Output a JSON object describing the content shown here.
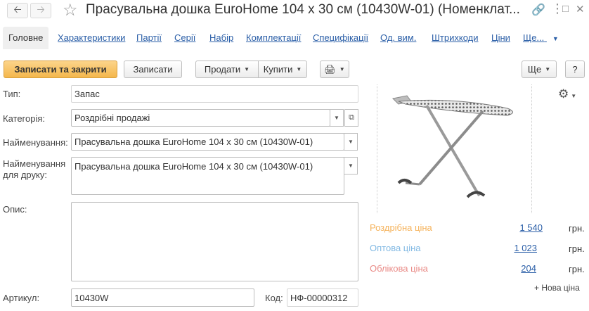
{
  "window": {
    "title": "Прасувальна дошка EuroHome 104 x 30 см (10430W-01) (Номенклат..."
  },
  "tabs": [
    {
      "label": "Головне"
    },
    {
      "label": "Характеристики"
    },
    {
      "label": "Партії"
    },
    {
      "label": "Серії"
    },
    {
      "label": "Набір"
    },
    {
      "label": "Комплектації"
    },
    {
      "label": "Специфікації"
    },
    {
      "label": "Од. вим."
    },
    {
      "label": "Штрихкоди"
    },
    {
      "label": "Ціни"
    },
    {
      "label": "Ще..."
    }
  ],
  "toolbar": {
    "save_close": "Записати та закрити",
    "save": "Записати",
    "sell": "Продати",
    "buy": "Купити",
    "more": "Ще",
    "help": "?"
  },
  "form": {
    "type_label": "Тип:",
    "type_value": "Запас",
    "category_label": "Категорія:",
    "category_value": "Роздрібні продажі",
    "name_label": "Найменування:",
    "name_value": "Прасувальна дошка EuroHome 104 x 30 см (10430W-01)",
    "print_name_label_1": "Найменування",
    "print_name_label_2": "для друку:",
    "print_name_value": "Прасувальна дошка EuroHome 104 x 30 см (10430W-01)",
    "description_label": "Опис:",
    "description_value": "",
    "article_label": "Артикул:",
    "article_value": "10430W",
    "code_label": "Код:",
    "code_value": "НФ-00000312"
  },
  "prices": [
    {
      "label": "Роздрібна ціна",
      "value": "1 540",
      "unit": "грн.",
      "color": "#f5b25a"
    },
    {
      "label": "Оптова ціна",
      "value": "1 023",
      "unit": "грн.",
      "color": "#82b9e3"
    },
    {
      "label": "Облікова ціна",
      "value": "204",
      "unit": "грн.",
      "color": "#e98a86"
    }
  ],
  "new_price_link": "+ Нова ціна"
}
